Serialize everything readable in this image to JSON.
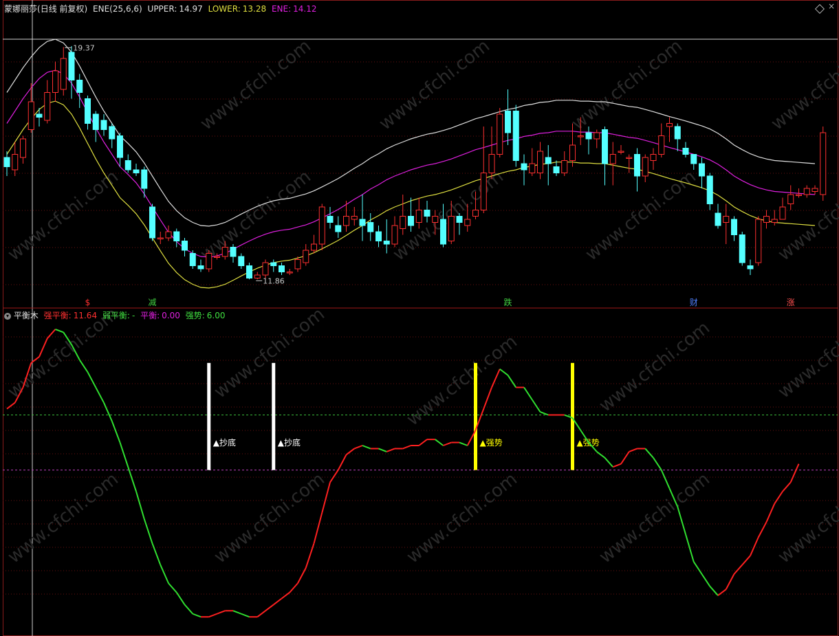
{
  "top_panel": {
    "stock_name": "蒙娜丽莎",
    "period": "(日线 前复权)",
    "indicator": "ENE(25,6,6)",
    "upper_label": "UPPER:",
    "upper_value": "14.97",
    "lower_label": "LOWER:",
    "lower_value": "13.28",
    "ene_label": "ENE:",
    "ene_value": "14.12",
    "high_label": "19.37",
    "low_label": "11.86",
    "markers": [
      {
        "text": "$",
        "color": "#ff3030",
        "candle": 10
      },
      {
        "text": "减",
        "color": "#40d040",
        "candle": 18
      },
      {
        "text": "跌",
        "color": "#40d040",
        "candle": 62
      },
      {
        "text": "财",
        "color": "#5080ff",
        "candle": 85
      },
      {
        "text": "涨",
        "color": "#ff5050",
        "candle": 97
      }
    ]
  },
  "bottom_panel": {
    "indicator_name": "平衡木",
    "strong_label": "强平衡:",
    "strong_value": "11.64",
    "weak_label": "弱平衡:",
    "weak_value": "-",
    "balance_label": "平衡:",
    "balance_value": "0.00",
    "trend_label": "强势:",
    "trend_value": "6.00",
    "signals": [
      {
        "text": "抄底",
        "color": "#ffffff",
        "candle": 25
      },
      {
        "text": "抄底",
        "color": "#ffffff",
        "candle": 33
      },
      {
        "text": "强势",
        "color": "#ffff00",
        "candle": 58
      },
      {
        "text": "强势",
        "color": "#ffff00",
        "candle": 70
      }
    ]
  },
  "watermark": "www.cfchi.com",
  "colors": {
    "up": "#ff3030",
    "down": "#54ffff",
    "upper": "#e0e0e0",
    "mid": "#e020e0",
    "lower": "#e0e040"
  },
  "chart_data": [
    {
      "type": "candlestick",
      "title": "ENE(25,6,6)",
      "ylim": [
        11.0,
        20.4
      ],
      "candles": [
        [
          15.8,
          15.5,
          16.0,
          15.2
        ],
        [
          15.4,
          15.9,
          16.3,
          15.2
        ],
        [
          15.8,
          16.4,
          16.5,
          15.6
        ],
        [
          16.7,
          17.6,
          18.2,
          16.6
        ],
        [
          17.2,
          17.1,
          17.4,
          16.8
        ],
        [
          17.0,
          17.9,
          18.3,
          16.9
        ],
        [
          17.9,
          18.6,
          18.9,
          17.6
        ],
        [
          18.0,
          19.0,
          19.37,
          17.8
        ],
        [
          19.2,
          18.3,
          19.4,
          17.7
        ],
        [
          18.3,
          17.9,
          18.5,
          17.4
        ],
        [
          17.7,
          16.9,
          17.8,
          16.7
        ],
        [
          17.2,
          16.7,
          17.3,
          16.3
        ],
        [
          17.0,
          16.7,
          17.2,
          16.5
        ],
        [
          16.8,
          16.4,
          16.9,
          16.1
        ],
        [
          16.5,
          15.8,
          16.6,
          15.5
        ],
        [
          15.7,
          15.4,
          15.9,
          15.3
        ],
        [
          15.4,
          15.3,
          15.6,
          15.2
        ],
        [
          15.4,
          14.8,
          15.5,
          14.5
        ],
        [
          14.2,
          13.2,
          14.3,
          13.1
        ],
        [
          13.2,
          13.2,
          13.4,
          13.0
        ],
        [
          13.2,
          13.4,
          13.6,
          13.1
        ],
        [
          13.4,
          13.1,
          13.5,
          12.9
        ],
        [
          13.1,
          12.8,
          13.2,
          12.6
        ],
        [
          12.7,
          12.3,
          12.8,
          12.2
        ],
        [
          12.3,
          12.2,
          12.5,
          12.1
        ],
        [
          12.2,
          12.7,
          12.8,
          12.1
        ],
        [
          12.6,
          12.6,
          12.7,
          12.5
        ],
        [
          12.6,
          12.9,
          13.1,
          12.5
        ],
        [
          12.9,
          12.6,
          13.0,
          12.4
        ],
        [
          12.6,
          12.3,
          12.7,
          12.2
        ],
        [
          12.3,
          11.9,
          12.4,
          11.86
        ],
        [
          11.9,
          12.0,
          12.1,
          11.86
        ],
        [
          12.0,
          12.4,
          12.5,
          11.9
        ],
        [
          12.4,
          12.3,
          12.5,
          12.1
        ],
        [
          12.3,
          12.1,
          12.4,
          12.0
        ],
        [
          12.1,
          12.1,
          12.2,
          12.0
        ],
        [
          12.2,
          12.5,
          12.6,
          12.1
        ],
        [
          12.4,
          12.8,
          13.0,
          12.3
        ],
        [
          12.8,
          13.0,
          13.3,
          12.7
        ],
        [
          13.0,
          14.2,
          14.3,
          12.8
        ],
        [
          13.9,
          13.7,
          14.2,
          13.5
        ],
        [
          13.6,
          13.4,
          13.9,
          13.2
        ],
        [
          13.6,
          13.9,
          14.4,
          13.4
        ],
        [
          13.8,
          13.9,
          14.2,
          13.6
        ],
        [
          13.8,
          13.6,
          14.6,
          13.1
        ],
        [
          13.7,
          13.4,
          14.0,
          13.1
        ],
        [
          13.4,
          13.1,
          13.6,
          12.9
        ],
        [
          13.1,
          13.0,
          13.8,
          12.7
        ],
        [
          13.0,
          13.6,
          13.9,
          12.9
        ],
        [
          13.5,
          13.9,
          14.6,
          13.3
        ],
        [
          13.9,
          13.6,
          14.5,
          13.4
        ],
        [
          13.7,
          14.1,
          14.5,
          13.5
        ],
        [
          14.1,
          13.9,
          14.4,
          13.7
        ],
        [
          13.7,
          13.9,
          14.1,
          13.3
        ],
        [
          13.8,
          13.0,
          14.3,
          12.9
        ],
        [
          13.1,
          13.9,
          14.4,
          13.0
        ],
        [
          13.9,
          13.7,
          14.0,
          13.3
        ],
        [
          13.6,
          13.8,
          14.3,
          13.4
        ],
        [
          13.9,
          14.1,
          14.7,
          13.8
        ],
        [
          14.1,
          15.3,
          16.8,
          14.0
        ],
        [
          15.3,
          15.9,
          16.8,
          15.1
        ],
        [
          15.9,
          17.2,
          17.4,
          15.8
        ],
        [
          17.3,
          16.6,
          18.0,
          16.2
        ],
        [
          17.3,
          15.7,
          17.5,
          15.5
        ],
        [
          15.6,
          15.4,
          15.9,
          14.9
        ],
        [
          15.3,
          15.6,
          16.1,
          15.2
        ],
        [
          15.3,
          16.0,
          16.3,
          15.1
        ],
        [
          15.8,
          15.6,
          16.2,
          14.9
        ],
        [
          15.5,
          15.3,
          15.7,
          15.2
        ],
        [
          15.3,
          15.7,
          16.0,
          15.2
        ],
        [
          15.7,
          16.2,
          16.9,
          15.5
        ],
        [
          16.5,
          16.5,
          17.1,
          16.2
        ],
        [
          16.6,
          16.4,
          16.8,
          15.9
        ],
        [
          16.4,
          16.6,
          16.7,
          16.1
        ],
        [
          16.7,
          15.6,
          16.8,
          14.9
        ],
        [
          15.6,
          15.9,
          16.3,
          14.9
        ],
        [
          16.0,
          16.0,
          16.2,
          15.9
        ],
        [
          15.8,
          15.8,
          15.9,
          15.3
        ],
        [
          15.9,
          15.2,
          16.1,
          14.7
        ],
        [
          15.2,
          15.8,
          15.9,
          15.0
        ],
        [
          15.7,
          15.9,
          16.1,
          15.4
        ],
        [
          15.9,
          16.5,
          16.9,
          15.8
        ],
        [
          16.8,
          16.9,
          17.1,
          16.3
        ],
        [
          16.8,
          16.4,
          16.9,
          16.0
        ],
        [
          16.1,
          15.9,
          16.3,
          15.8
        ],
        [
          15.9,
          15.6,
          15.8,
          15.4
        ],
        [
          15.6,
          15.2,
          15.8,
          14.8
        ],
        [
          15.2,
          14.3,
          15.3,
          14.1
        ],
        [
          14.0,
          13.6,
          14.3,
          13.5
        ],
        [
          13.7,
          13.9,
          14.3,
          13.0
        ],
        [
          13.8,
          13.3,
          13.9,
          13.1
        ],
        [
          13.3,
          12.4,
          13.4,
          12.3
        ],
        [
          12.3,
          12.2,
          12.5,
          12.0
        ],
        [
          12.4,
          13.8,
          13.9,
          12.3
        ],
        [
          13.7,
          13.9,
          14.1,
          13.5
        ],
        [
          13.7,
          13.8,
          14.1,
          13.6
        ],
        [
          13.8,
          14.2,
          14.5,
          13.9
        ],
        [
          14.3,
          14.6,
          14.9,
          14.1
        ],
        [
          14.6,
          14.6,
          14.8,
          14.5
        ],
        [
          14.6,
          14.8,
          14.9,
          14.5
        ],
        [
          14.7,
          14.8,
          14.9,
          14.6
        ],
        [
          14.6,
          16.6,
          16.8,
          14.4
        ]
      ],
      "ene": [
        16.9,
        17.3,
        17.7,
        18.05,
        18.35,
        18.55,
        18.62,
        18.5,
        18.2,
        17.75,
        17.25,
        16.75,
        16.3,
        15.9,
        15.5,
        15.25,
        14.98,
        14.62,
        14.2,
        13.78,
        13.38,
        13.08,
        12.85,
        12.7,
        12.6,
        12.58,
        12.62,
        12.7,
        12.83,
        12.97,
        13.1,
        13.22,
        13.32,
        13.4,
        13.45,
        13.48,
        13.55,
        13.62,
        13.72,
        13.85,
        13.98,
        14.12,
        14.28,
        14.45,
        14.6,
        14.78,
        14.92,
        15.08,
        15.2,
        15.3,
        15.4,
        15.48,
        15.55,
        15.6,
        15.67,
        15.75,
        15.85,
        15.95,
        16.05,
        16.12,
        16.2,
        16.28,
        16.35,
        16.4,
        16.48,
        16.52,
        16.58,
        16.6,
        16.65,
        16.65,
        16.65,
        16.62,
        16.62,
        16.6,
        16.6,
        16.55,
        16.5,
        16.45,
        16.42,
        16.35,
        16.28,
        16.2,
        16.12,
        16.05,
        15.98,
        15.9,
        15.82,
        15.72,
        15.58,
        15.4,
        15.2,
        15.05,
        14.92,
        14.82,
        14.75,
        14.7,
        14.68,
        14.66,
        14.64,
        14.62,
        14.6
      ],
      "upper": [
        17.9,
        18.3,
        18.7,
        19.05,
        19.35,
        19.55,
        19.62,
        19.5,
        19.2,
        18.75,
        18.25,
        17.75,
        17.3,
        16.9,
        16.5,
        16.25,
        15.98,
        15.62,
        15.2,
        14.78,
        14.38,
        14.08,
        13.85,
        13.7,
        13.6,
        13.58,
        13.62,
        13.7,
        13.83,
        13.97,
        14.1,
        14.22,
        14.32,
        14.4,
        14.45,
        14.48,
        14.55,
        14.62,
        14.72,
        14.85,
        14.98,
        15.12,
        15.28,
        15.45,
        15.6,
        15.78,
        15.92,
        16.08,
        16.2,
        16.3,
        16.4,
        16.48,
        16.55,
        16.6,
        16.67,
        16.75,
        16.85,
        16.95,
        17.05,
        17.12,
        17.2,
        17.28,
        17.35,
        17.4,
        17.48,
        17.52,
        17.58,
        17.6,
        17.65,
        17.65,
        17.65,
        17.62,
        17.62,
        17.6,
        17.6,
        17.55,
        17.5,
        17.45,
        17.42,
        17.35,
        17.28,
        17.2,
        17.12,
        17.05,
        16.98,
        16.9,
        16.82,
        16.72,
        16.58,
        16.4,
        16.2,
        16.05,
        15.92,
        15.82,
        15.75,
        15.7,
        15.68,
        15.66,
        15.64,
        15.62,
        15.6
      ],
      "lower": [
        15.9,
        16.3,
        16.7,
        17.05,
        17.35,
        17.55,
        17.62,
        17.5,
        17.2,
        16.75,
        16.25,
        15.75,
        15.3,
        14.9,
        14.5,
        14.25,
        13.98,
        13.62,
        13.2,
        12.78,
        12.38,
        12.08,
        11.85,
        11.7,
        11.6,
        11.58,
        11.62,
        11.7,
        11.83,
        11.97,
        12.1,
        12.22,
        12.32,
        12.4,
        12.45,
        12.48,
        12.55,
        12.62,
        12.72,
        12.85,
        12.98,
        13.12,
        13.28,
        13.45,
        13.6,
        13.78,
        13.92,
        14.08,
        14.2,
        14.3,
        14.4,
        14.48,
        14.55,
        14.6,
        14.67,
        14.75,
        14.85,
        14.95,
        15.05,
        15.12,
        15.2,
        15.28,
        15.35,
        15.4,
        15.48,
        15.52,
        15.58,
        15.6,
        15.65,
        15.65,
        15.65,
        15.62,
        15.62,
        15.6,
        15.6,
        15.55,
        15.5,
        15.45,
        15.42,
        15.35,
        15.28,
        15.2,
        15.12,
        15.05,
        14.98,
        14.9,
        14.82,
        14.72,
        14.58,
        14.4,
        14.2,
        14.05,
        13.92,
        13.82,
        13.75,
        13.7,
        13.68,
        13.66,
        13.64,
        13.62,
        13.6
      ]
    },
    {
      "type": "line",
      "title": "平衡木",
      "ylim": [
        0,
        100
      ],
      "series": [
        {
          "name": "强平衡",
          "values": [
            72,
            74,
            79,
            87,
            89,
            95,
            98,
            97,
            93,
            88,
            84,
            79,
            74,
            68,
            61,
            53,
            45,
            36,
            28,
            21,
            15,
            12,
            8,
            5,
            4,
            4,
            5,
            6,
            6,
            5,
            4,
            4,
            6,
            8,
            10,
            12,
            15,
            20,
            28,
            38,
            48,
            52,
            57,
            59,
            60,
            59,
            59,
            58,
            59,
            59,
            60,
            60,
            62,
            62,
            60,
            61,
            61,
            60,
            65,
            72,
            79,
            85,
            83,
            79,
            79,
            75,
            71,
            70,
            70,
            70,
            69,
            65,
            61,
            58,
            56,
            53,
            54,
            58,
            59,
            59,
            56,
            52,
            46,
            40,
            31,
            22,
            18,
            14,
            11,
            13,
            18,
            21,
            24,
            30,
            35,
            41,
            45,
            48,
            54
          ]
        }
      ],
      "strong_threshold": 70,
      "balance_level": 52
    }
  ]
}
